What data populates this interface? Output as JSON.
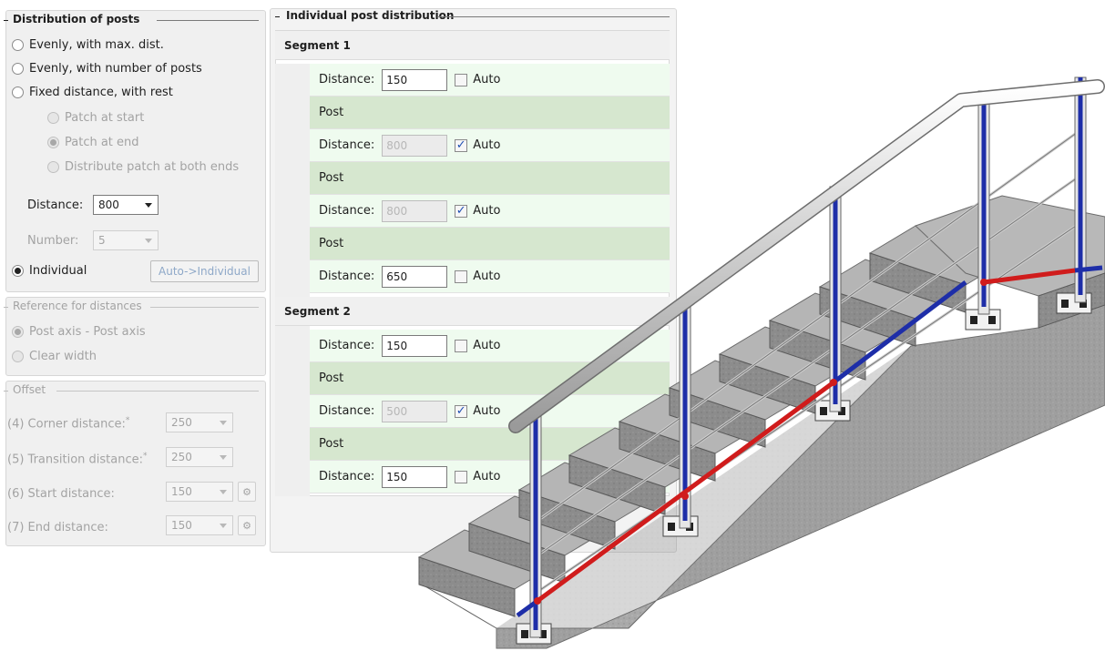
{
  "distribution_of_posts": {
    "title": "Distribution of posts",
    "options": [
      {
        "label": "Evenly, with max. dist.",
        "selected": false,
        "enabled": true
      },
      {
        "label": "Evenly, with number of posts",
        "selected": false,
        "enabled": true
      },
      {
        "label": "Fixed distance, with rest",
        "selected": false,
        "enabled": true
      }
    ],
    "patch_options": [
      {
        "label": "Patch at start",
        "selected": false,
        "enabled": false
      },
      {
        "label": "Patch at end",
        "selected": true,
        "enabled": false
      },
      {
        "label": "Distribute patch at both ends",
        "selected": false,
        "enabled": false
      }
    ],
    "distance_label": "Distance:",
    "distance_value": "800",
    "number_label": "Number:",
    "number_value": "5",
    "individual_label": "Individual",
    "individual_selected": true,
    "auto_individual_button": "Auto->Individual"
  },
  "reference_for_distances": {
    "title": "Reference for distances",
    "options": [
      {
        "label": "Post axis - Post axis",
        "selected": true,
        "enabled": false
      },
      {
        "label": "Clear width",
        "selected": false,
        "enabled": false
      }
    ]
  },
  "offset": {
    "title": "Offset",
    "fields": [
      {
        "label": "(4) Corner distance:",
        "asterisk": "*",
        "value": "250"
      },
      {
        "label": "(5) Transition distance:",
        "asterisk": "*",
        "value": "250"
      },
      {
        "label": "(6) Start distance:",
        "value": "150"
      },
      {
        "label": "(7) End distance:",
        "value": "150"
      }
    ]
  },
  "individual_post_distribution": {
    "title": "Individual post distribution",
    "distance_label": "Distance:",
    "auto_label": "Auto",
    "post_label": "Post",
    "segments": [
      {
        "label": "Segment 1",
        "rows": [
          {
            "type": "distance",
            "value": "150",
            "auto": false
          },
          {
            "type": "post"
          },
          {
            "type": "distance",
            "value": "800",
            "auto": true
          },
          {
            "type": "post"
          },
          {
            "type": "distance",
            "value": "800",
            "auto": true
          },
          {
            "type": "post"
          },
          {
            "type": "distance",
            "value": "650",
            "auto": false
          }
        ]
      },
      {
        "label": "Segment 2",
        "rows": [
          {
            "type": "distance",
            "value": "150",
            "auto": false
          },
          {
            "type": "post"
          },
          {
            "type": "distance",
            "value": "500",
            "auto": true
          },
          {
            "type": "post"
          },
          {
            "type": "distance",
            "value": "150",
            "auto": false
          }
        ]
      }
    ]
  },
  "colors": {
    "distance_row": "#effbef",
    "post_row": "#d6e7cf",
    "post_marker": "#1e2ea8",
    "distance_marker": "#d01c1c",
    "concrete": "#a8a8a8"
  },
  "illustration": {
    "name": "stair-railing-illustration"
  }
}
